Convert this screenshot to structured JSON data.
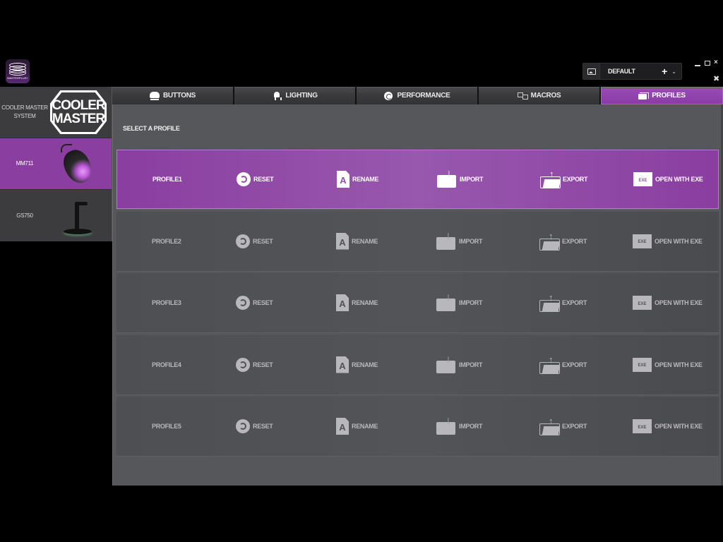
{
  "app": {
    "logo_text": "MASTERPLUS+",
    "active_profile": "DEFAULT",
    "add_profile_label": "+",
    "dropdown_label": "⌄",
    "window_controls": {
      "minimize": "–",
      "restore": "❐",
      "close": "×",
      "tools": "✖"
    }
  },
  "sidebar": {
    "items": [
      {
        "label": "COOLER MASTER SYSTEM",
        "image": "cooler-master-logo",
        "logo_text": "COOLER MASTER",
        "active": false
      },
      {
        "label": "MM711",
        "image": "mouse-image",
        "active": true
      },
      {
        "label": "GS750",
        "image": "headset-stand-image",
        "active": false
      }
    ]
  },
  "tabs": [
    {
      "label": "BUTTONS",
      "icon": "mouse-buttons-icon",
      "active": false
    },
    {
      "label": "LIGHTING",
      "icon": "lighting-icon",
      "active": false
    },
    {
      "label": "PERFORMANCE",
      "icon": "performance-icon",
      "active": false
    },
    {
      "label": "MACROS",
      "icon": "macros-icon",
      "active": false
    },
    {
      "label": "PROFILES",
      "icon": "profiles-icon",
      "active": true
    }
  ],
  "main": {
    "section_title": "SELECT A PROFILE",
    "actions": {
      "reset": "RESET",
      "rename": "RENAME",
      "import": "IMPORT",
      "export": "EXPORT",
      "open_exe": "OPEN WITH EXE",
      "exe_badge": "EXE",
      "rename_glyph": "A"
    },
    "profiles": [
      {
        "name": "PROFILE1",
        "active": true
      },
      {
        "name": "PROFILE2",
        "active": false
      },
      {
        "name": "PROFILE3",
        "active": false
      },
      {
        "name": "PROFILE4",
        "active": false
      },
      {
        "name": "PROFILE5",
        "active": false
      }
    ]
  },
  "colors": {
    "accent": "#8a3fa0",
    "panel": "#55575b",
    "row": "#505256",
    "tab": "#3a3a3c"
  }
}
